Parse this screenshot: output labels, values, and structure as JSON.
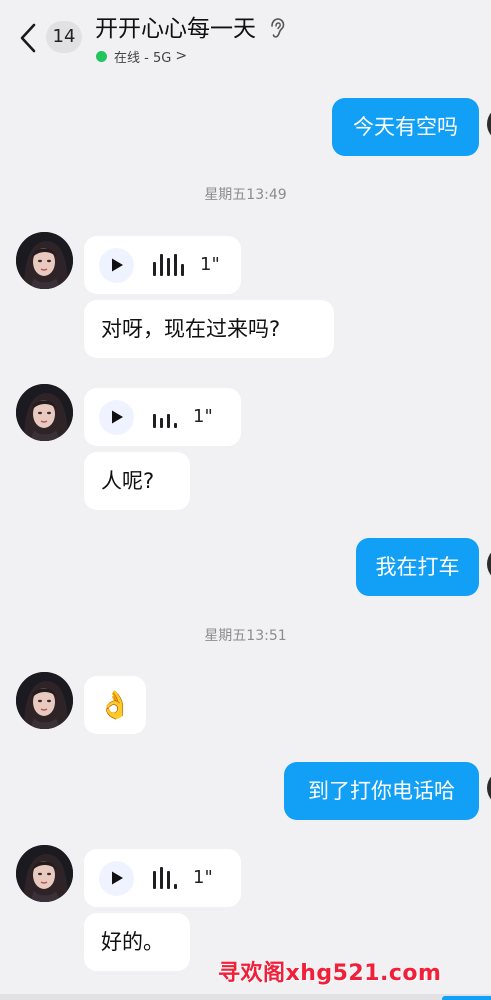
{
  "header": {
    "unread_count": "14",
    "title": "开开心心每一天",
    "status": "在线 - 5G",
    "status_chevron": ">"
  },
  "messages": {
    "m1": "今天有空吗",
    "ts1": "星期五13:49",
    "voice1_duration": "1\"",
    "m2": "对呀，现在过来吗?",
    "voice2_duration": "1\"",
    "m3": "人呢?",
    "m4": "我在打车",
    "ts2": "星期五13:51",
    "emoji1": "👌",
    "m5": "到了打你电话哈",
    "voice3_duration": "1\"",
    "m6": "好的。"
  },
  "watermark": "寻欢阁xhg521.com",
  "colors": {
    "outgoing_bubble": "#12a0f6",
    "incoming_bubble": "#ffffff",
    "background": "#f1f1f3",
    "online_dot": "#22c55e",
    "watermark": "#f0203a"
  },
  "icons": {
    "back": "chevron-left-icon",
    "ear": "ear-icon",
    "play": "play-icon",
    "voice_wave": "voice-wave-icon"
  }
}
